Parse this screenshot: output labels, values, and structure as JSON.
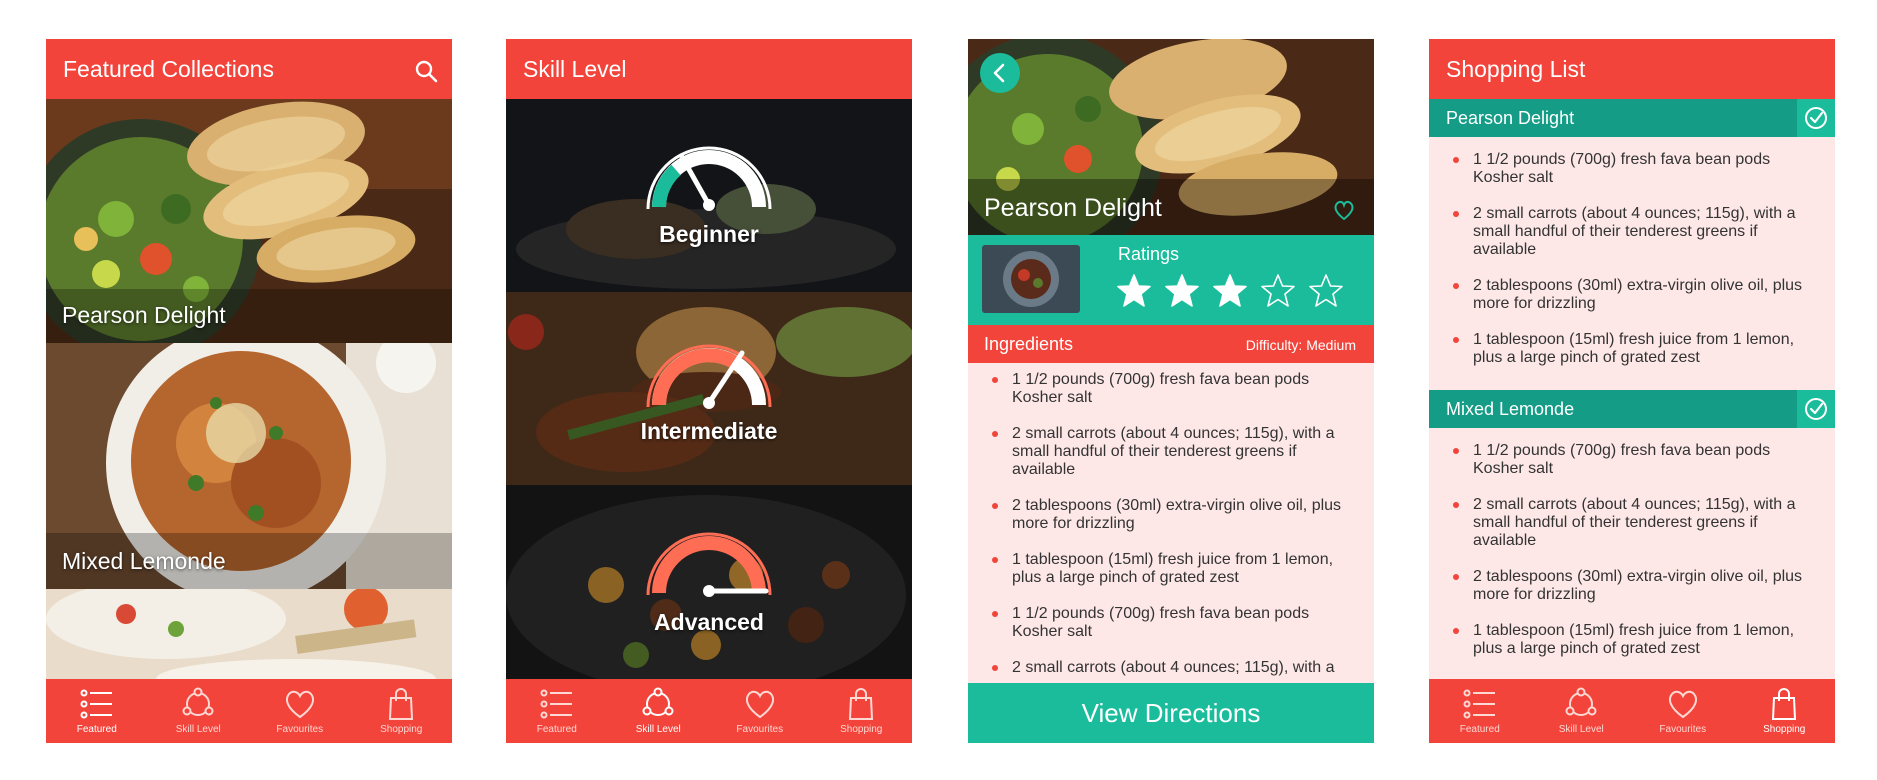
{
  "tabbar": {
    "featured": "Featured",
    "skill_level": "Skill Level",
    "favourites": "Favourites",
    "shopping": "Shopping"
  },
  "screen1": {
    "title": "Featured Collections",
    "cards": [
      "Pearson Delight",
      "Mixed Lemonde"
    ]
  },
  "screen2": {
    "title": "Skill Level",
    "levels": [
      "Beginner",
      "Intermediate",
      "Advanced"
    ]
  },
  "screen3": {
    "title": "Pearson Delight",
    "ratings_label": "Ratings",
    "rating": 3,
    "rating_max": 5,
    "ingredients_label": "Ingredients",
    "difficulty": "Difficulty: Medium",
    "ingredients": [
      "1 1/2 pounds (700g) fresh fava bean pods Kosher salt",
      "2 small carrots (about 4 ounces; 115g), with a small handful of their tenderest greens if available",
      "2 tablespoons (30ml) extra-virgin olive oil, plus more for drizzling",
      "1 tablespoon (15ml) fresh juice from 1 lemon, plus a large pinch of grated zest",
      "1 1/2 pounds (700g) fresh fava bean pods Kosher salt",
      "2 small carrots (about 4 ounces; 115g), with a"
    ],
    "view_button": "View Directions"
  },
  "screen4": {
    "title": "Shopping List",
    "groups": [
      {
        "name": "Pearson Delight",
        "items": [
          "1 1/2 pounds (700g) fresh fava bean pods Kosher salt",
          "2 small carrots (about 4 ounces; 115g), with a small handful of their tenderest greens if available",
          "2 tablespoons (30ml) extra-virgin olive oil, plus more for drizzling",
          "1 tablespoon (15ml) fresh juice from 1 lemon, plus a large pinch of grated zest"
        ]
      },
      {
        "name": "Mixed Lemonde",
        "items": [
          "1 1/2 pounds (700g) fresh fava bean pods Kosher salt",
          "2 small carrots (about 4 ounces; 115g), with a small handful of their tenderest greens if available",
          "2 tablespoons (30ml) extra-virgin olive oil, plus more for drizzling",
          "1 tablespoon (15ml) fresh juice from 1 lemon, plus a large pinch of grated zest"
        ]
      }
    ]
  },
  "colors": {
    "primary_red": "#f2443b",
    "teal": "#1abc9c",
    "dark_teal": "#149c86",
    "list_background": "#fde8e7"
  },
  "icons": {
    "search": "search-icon",
    "featured": "list-icon",
    "skill_level": "share-cycle-icon",
    "favourites": "heart-icon",
    "shopping": "shopping-bag-icon",
    "back": "chevron-left-icon",
    "check": "check-circle-icon",
    "star": "star-icon"
  }
}
